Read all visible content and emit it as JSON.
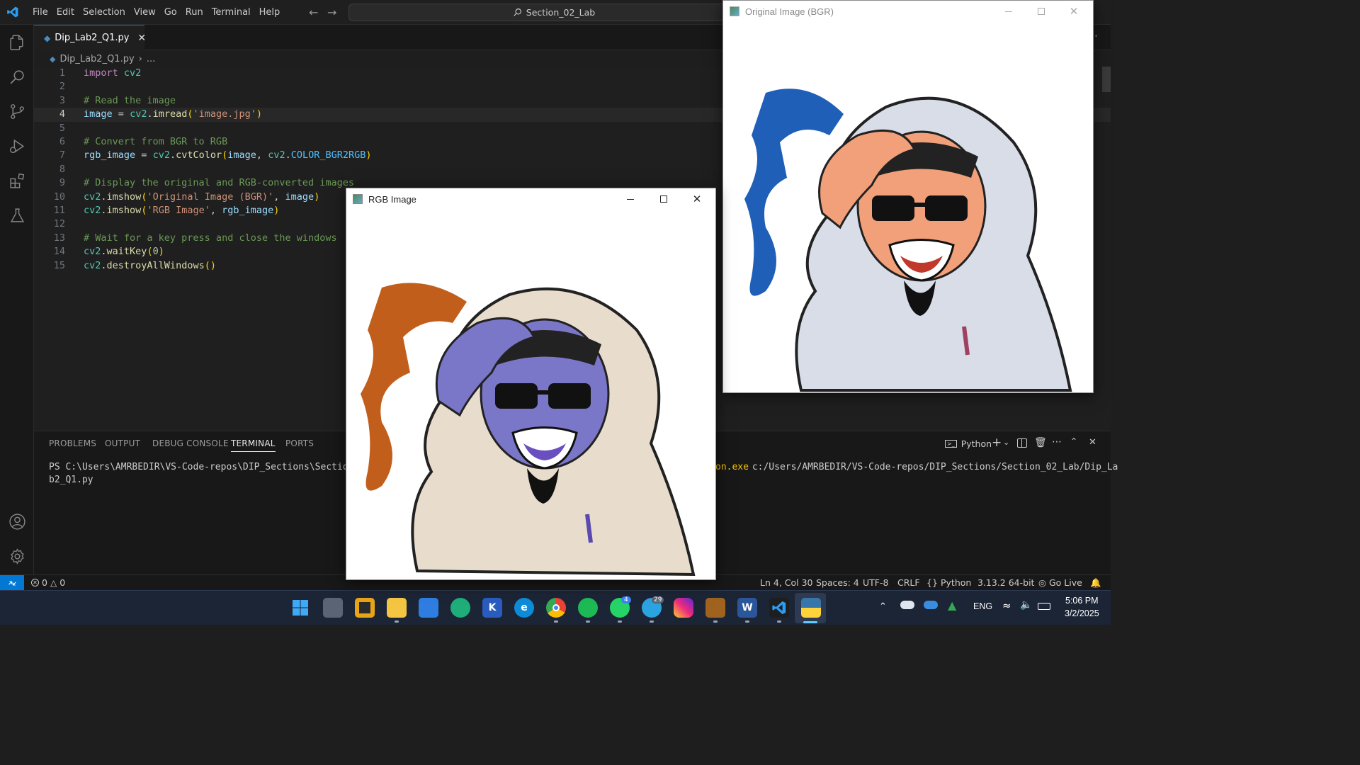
{
  "titlebar": {
    "menu": [
      "File",
      "Edit",
      "Selection",
      "View",
      "Go",
      "Run",
      "Terminal",
      "Help"
    ],
    "search": "Section_02_Lab"
  },
  "tab": {
    "label": "Dip_Lab2_Q1.py"
  },
  "breadcrumb": {
    "file": "Dip_Lab2_Q1.py",
    "more": "..."
  },
  "editor": {
    "line_numbers": [
      "1",
      "2",
      "3",
      "4",
      "5",
      "6",
      "7",
      "8",
      "9",
      "10",
      "11",
      "12",
      "13",
      "14",
      "15"
    ],
    "active_line": 4
  },
  "panel": {
    "tabs": [
      "PROBLEMS",
      "OUTPUT",
      "DEBUG CONSOLE",
      "TERMINAL",
      "PORTS"
    ],
    "active_tab": "TERMINAL",
    "shell": "Python",
    "terminal_line1_left": "PS C:\\Users\\AMRBEDIR\\VS-Code-repos\\DIP_Sections\\Section_0",
    "terminal_line1_exe": "on.exe",
    "terminal_line1_right": " c:/Users/AMRBEDIR/VS-Code-repos/DIP_Sections/Section_02_Lab/Dip_La",
    "terminal_line2": "b2_Q1.py"
  },
  "statusbar": {
    "errors": "0",
    "warnings": "0",
    "position": "Ln 4, Col 30",
    "spaces": "Spaces: 4",
    "encoding": "UTF-8",
    "eol": "CRLF",
    "language": "Python",
    "interpreter": "3.13.2 64-bit",
    "golive": "Go Live"
  },
  "windows": {
    "rgb": {
      "title": "RGB Image"
    },
    "bgr": {
      "title": "Original Image (BGR)"
    }
  },
  "taskbar": {
    "lang": "ENG",
    "time": "5:06 PM",
    "date": "3/2/2025",
    "whatsapp_badge": "4",
    "telegram_badge": "29"
  },
  "colors": {
    "accent": "#0078d4",
    "rgb_tint": "#c25e1c",
    "bgr_tint": "#1f5fb8"
  }
}
